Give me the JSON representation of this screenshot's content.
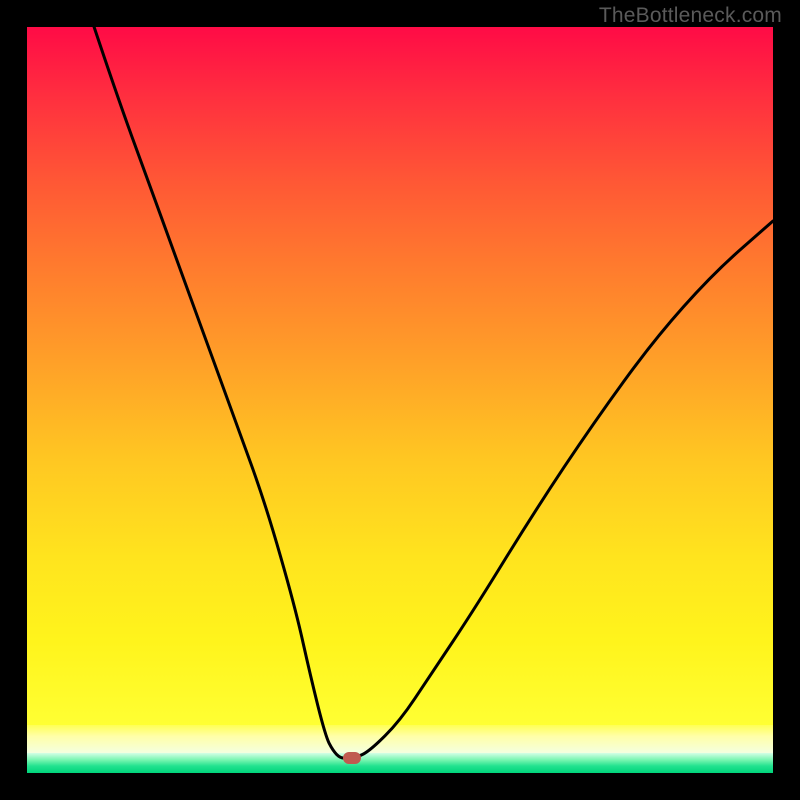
{
  "watermark": "TheBottleneck.com",
  "chart_data": {
    "type": "line",
    "title": "",
    "xlabel": "",
    "ylabel": "",
    "xlim": [
      0,
      100
    ],
    "ylim": [
      0,
      100
    ],
    "grid": false,
    "series": [
      {
        "name": "bottleneck-curve",
        "x": [
          9,
          12,
          16,
          20,
          24,
          28,
          32,
          36,
          38,
          40,
          41,
          42,
          43,
          44,
          46,
          50,
          54,
          60,
          68,
          76,
          84,
          92,
          100
        ],
        "y": [
          100,
          91,
          80,
          69,
          58,
          47,
          36,
          22,
          13,
          5,
          3,
          2,
          2,
          2,
          3,
          7,
          13,
          22,
          35,
          47,
          58,
          67,
          74
        ]
      }
    ],
    "marker": {
      "x": 43.5,
      "y": 2
    },
    "background_gradient": {
      "top_color": "#ff0b46",
      "mid_color": "#ffe41e",
      "bottom_color": "#00d47b"
    }
  }
}
